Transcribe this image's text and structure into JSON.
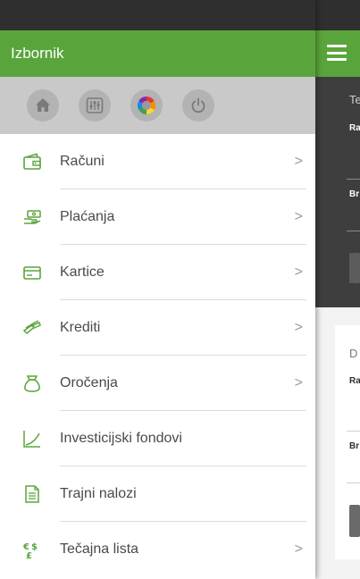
{
  "drawer": {
    "title": "Izbornik",
    "quick_actions": [
      {
        "name": "home-icon"
      },
      {
        "name": "settings-sliders-icon"
      },
      {
        "name": "color-wheel-icon"
      },
      {
        "name": "power-icon"
      }
    ],
    "items": [
      {
        "label": "Računi",
        "icon": "wallet-icon",
        "chevron": ">"
      },
      {
        "label": "Plaćanja",
        "icon": "payment-hand-icon",
        "chevron": ">"
      },
      {
        "label": "Kartice",
        "icon": "card-icon",
        "chevron": ">"
      },
      {
        "label": "Krediti",
        "icon": "money-loan-icon",
        "chevron": ">"
      },
      {
        "label": "Oročenja",
        "icon": "money-bag-icon",
        "chevron": ">"
      },
      {
        "label": "Investicijski fondovi",
        "icon": "growth-chart-icon",
        "chevron": ""
      },
      {
        "label": "Trajni nalozi",
        "icon": "document-icon",
        "chevron": ""
      },
      {
        "label": "Tečajna lista",
        "icon": "currency-exchange-icon",
        "chevron": ">"
      }
    ]
  },
  "background": {
    "section1_initial": "Te",
    "section1_label": "Ra",
    "section1_label2": "Br",
    "section2_initial": "D",
    "section2_label": "Ra",
    "section2_label2": "Br"
  },
  "colors": {
    "accent": "#5aa53b",
    "statusbar": "#2f2f2f",
    "quickbar": "#c9c9c9"
  }
}
